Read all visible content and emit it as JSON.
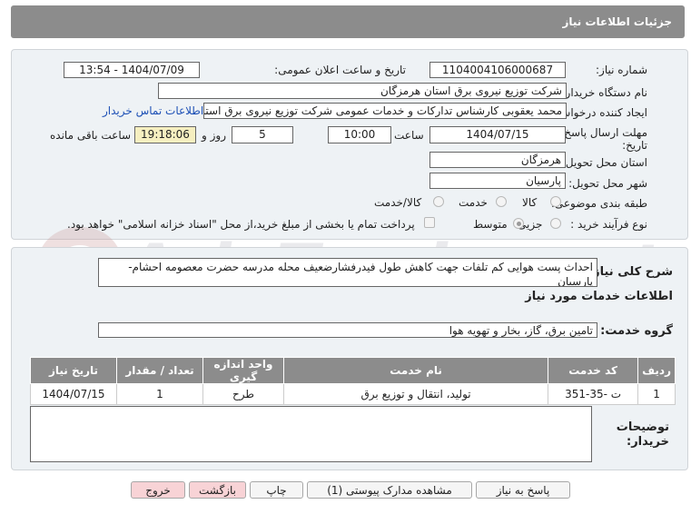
{
  "header": {
    "title": "جزئیات اطلاعات نیاز"
  },
  "form": {
    "need_number_label": "شماره نیاز:",
    "need_number": "1104004106000687",
    "announce_label": "تاریخ و ساعت اعلان عمومی:",
    "announce_value": "1404/07/09 - 13:54",
    "buyer_org_label": "نام دستگاه خریدار:",
    "buyer_org": "شرکت توزیع نیروی برق استان هرمزگان",
    "creator_label": "ایجاد کننده درخواست:",
    "creator": "محمد یعقوبی کارشناس تدارکات و خدمات عمومی شرکت توزیع نیروی برق استان",
    "contact_link": "اطلاعات تماس خریدار",
    "deadline_label_1": "مهلت ارسال پاسخ: تا",
    "deadline_label_2": "تاریخ:",
    "deadline_date": "1404/07/15",
    "time_label": "ساعت",
    "deadline_time": "10:00",
    "days_value": "5",
    "days_label": "روز و",
    "remaining_time": "19:18:06",
    "remaining_label": "ساعت باقی مانده",
    "province_label": "استان محل تحویل:",
    "province": "هرمزگان",
    "city_label": "شهر محل تحویل:",
    "city": "پارسیان",
    "category_label": "طبقه بندی موضوعی:",
    "category_options": [
      "کالا",
      "خدمت",
      "کالا/خدمت"
    ],
    "category_selected": "خدمت",
    "process_label": "نوع فرآیند خرید :",
    "process_options": [
      "جزیی",
      "متوسط"
    ],
    "process_selected": "متوسط",
    "payment_note": "پرداخت تمام یا بخشی از مبلغ خرید،از محل \"اسناد خزانه اسلامی\" خواهد بود."
  },
  "summary": {
    "label": "شرح کلی نیاز:",
    "text": "احداث پست هوایی کم تلفات جهت کاهش طول فیدرفشارضعیف محله مدرسه حضرت معصومه احشام-پارسیان"
  },
  "services": {
    "section_title": "اطلاعات خدمات مورد نیاز",
    "group_label": "گروه خدمت:",
    "group_value": "تامین برق، گاز، بخار و تهویه هوا",
    "columns": [
      "ردیف",
      "کد خدمت",
      "نام خدمت",
      "واحد اندازه گیری",
      "تعداد / مقدار",
      "تاریخ نیاز"
    ],
    "rows": [
      {
        "row": "1",
        "code": "ت -35-351",
        "name": "تولید، انتقال و توزیع برق",
        "unit": "طرح",
        "qty": "1",
        "date": "1404/07/15"
      }
    ]
  },
  "buyer_notes": {
    "label_1": "توضیحات",
    "label_2": "خریدار:",
    "text": ""
  },
  "buttons": {
    "reply": "پاسخ به نیاز",
    "attachments": "مشاهده مدارک پیوستی (1)",
    "print": "چاپ",
    "back": "بازگشت",
    "exit": "خروج"
  },
  "watermark": {
    "text": "AriaTender.net"
  },
  "colors": {
    "header_bg": "#8c8c8c",
    "panel_bg": "#eef2f5",
    "link": "#1c4fb5",
    "yellow": "#f6efc0",
    "pink_button": "#f8d3d6"
  }
}
